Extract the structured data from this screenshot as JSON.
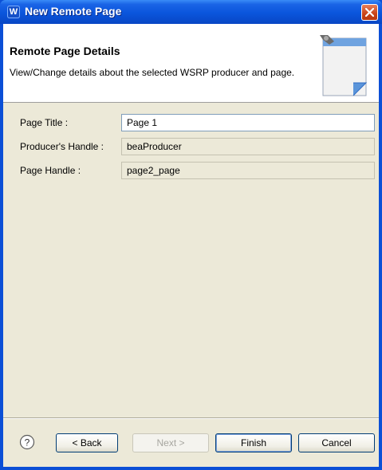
{
  "window": {
    "title": "New Remote Page"
  },
  "header": {
    "title": "Remote Page Details",
    "description": "View/Change details about the selected WSRP producer and page."
  },
  "form": {
    "page_title_label": "Page Title :",
    "page_title_value": "Page 1",
    "producer_handle_label": "Producer's Handle :",
    "producer_handle_value": "beaProducer",
    "page_handle_label": "Page Handle :",
    "page_handle_value": "page2_page"
  },
  "buttons": {
    "help": "?",
    "back": "< Back",
    "next": "Next >",
    "finish": "Finish",
    "cancel": "Cancel"
  },
  "colors": {
    "titlebar": "#0a55dc",
    "close_button": "#c94418",
    "dialog_face": "#ece9d8",
    "field_border": "#7f9db9"
  },
  "icons": [
    "app-icon",
    "close-icon",
    "wizard-page-icon",
    "help-icon"
  ]
}
